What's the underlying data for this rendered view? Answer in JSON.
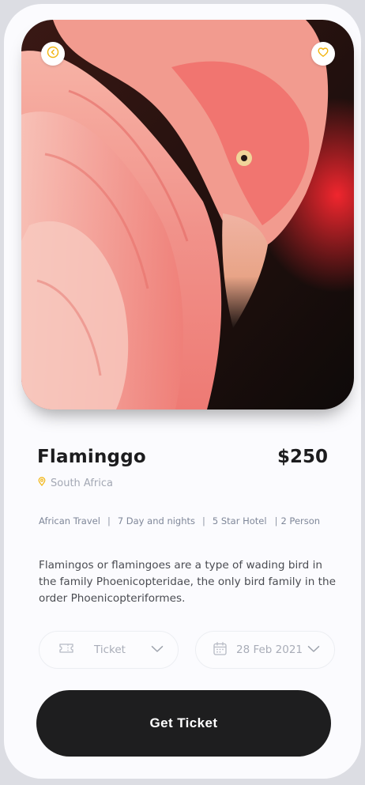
{
  "destination": {
    "title": "Flaminggo",
    "price": "$250",
    "location": "South Africa"
  },
  "tags": [
    "African Travel",
    "7 Day and nights",
    "5 Star Hotel",
    "2 Person"
  ],
  "description": "Flamingos or flamingoes are a type of wading bird in the family Phoenicopteridae, the only bird family in the order Phoenicopteriformes.",
  "ticket_select": {
    "value": "Ticket"
  },
  "date_select": {
    "value": "28 Feb 2021"
  },
  "cta": {
    "label": "Get Ticket"
  },
  "icons": {
    "back": "chevron-left-icon",
    "favorite": "heart-icon",
    "location": "map-pin-icon",
    "ticket": "ticket-icon",
    "calendar": "calendar-icon",
    "dropdown": "chevron-down-icon"
  },
  "colors": {
    "accent": "#f2b40f",
    "button": "#1e1e1f",
    "flamingo": "#f46a66"
  }
}
